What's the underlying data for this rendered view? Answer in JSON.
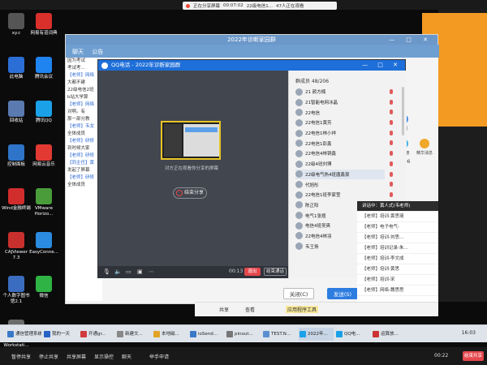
{
  "share_bar_top": {
    "sharing_text": "正在分享屏幕",
    "elapsed": "00:07:02",
    "group_text": "22级电信1...",
    "viewers_text": "47人正在观看"
  },
  "desktop_icons": [
    {
      "label": "xy.c",
      "color": "#555"
    },
    {
      "label": "网易有道词典",
      "color": "#d9302c"
    },
    {
      "label": "此电脑",
      "color": "#2b6fd6"
    },
    {
      "label": "腾讯会议",
      "color": "#1f84f0"
    },
    {
      "label": "回收站",
      "color": "#5a7ab0"
    },
    {
      "label": "腾讯QQ",
      "color": "#1ba1e8"
    },
    {
      "label": "控制面板",
      "color": "#2e74c8"
    },
    {
      "label": "网易云音乐",
      "color": "#e23a33"
    },
    {
      "label": "Wind金融终端",
      "color": "#d22d2d"
    },
    {
      "label": "VMware Horizo...",
      "color": "#4a9c3b"
    },
    {
      "label": "CAJViewer 7.3",
      "color": "#c8302e"
    },
    {
      "label": "EasyConne...",
      "color": "#2a8be0"
    },
    {
      "label": "个人数字图书馆2.1",
      "color": "#3a6dbf"
    },
    {
      "label": "微信",
      "color": "#2fb344"
    },
    {
      "label": "VMware Workstati...",
      "color": "#6b6b6b"
    }
  ],
  "main_window": {
    "title": "2022年诊断家园群",
    "tabs": [
      "聊天",
      "公告"
    ],
    "chat_lines": [
      "因为考试",
      "考试考...",
      "【老师】网络",
      "大都不建",
      "22级电信2班",
      "b站大学算",
      "【老师】网络",
      "对啊。有",
      "那一部分教",
      "【老师】韦龙",
      "全体成员",
      "【老师】研修",
      "到时候大家",
      "【老师】研修",
      "【同主任】黄",
      "发起了屏幕",
      "【老师】研修",
      "全体成员"
    ],
    "side_tools": [
      "空间",
      "群相册",
      "精华消息"
    ],
    "close_label": "关闭(C)",
    "send_label": "发送(S)",
    "member_count_back": "/206"
  },
  "call_window": {
    "title": "QQ电话 - 2022年诊断家园群",
    "share_hint": "对方正在观看你分享的屏幕",
    "end_share_label": "结束分享",
    "call_time": "00:13",
    "hangup_label": "退出",
    "end_call_label": "结束通话",
    "members_count": "群成员 48/206",
    "members": [
      "21 颜方楠",
      "21智能电网冰晶",
      "22电信",
      "22电信1黄芳",
      "22电信1林小祥",
      "22电信1彭鑫",
      "22电信4林铜鑫",
      "22级4班刘博",
      "22级电气热4班唐鑫豪",
      "代旭彤",
      "22电信1班李家莹",
      "陈正阳",
      "电气1张煜",
      "电信4班吴爽",
      "22电信4林羽",
      "韦王扬"
    ]
  },
  "qq_list": {
    "header": "讲话中：黄人式(韦老师)",
    "rows": [
      "【老师】培训-黄思琦",
      "【老师】电子电气-",
      "【老师】培训-刘思…",
      "【老师】培训记录-朱…",
      "【老师】培训-李文成",
      "【老师】培训-黄思",
      "【老师】培训-宋",
      "【老师】网络-魏思思"
    ]
  },
  "explorer": {
    "items": [
      "共享",
      "查看",
      "应用程序工具"
    ]
  },
  "taskbar": {
    "items": [
      {
        "label": "通信管理系统",
        "color": "#3a78c8"
      },
      {
        "label": "我的一天",
        "color": "#2563c7"
      },
      {
        "label": "开通gr...",
        "color": "#d13b3b"
      },
      {
        "label": "新建文...",
        "color": "#888"
      },
      {
        "label": "本地磁...",
        "color": "#e0a526"
      },
      {
        "label": "ioSend...",
        "color": "#3a78c8"
      },
      {
        "label": "pinout...",
        "color": "#777"
      },
      {
        "label": "TEST.N...",
        "color": "#5a8fd0"
      },
      {
        "label": "2022年...",
        "color": "#1ba1e8"
      },
      {
        "label": "QQ电...",
        "color": "#1ba1e8"
      },
      {
        "label": "运算放...",
        "color": "#c33"
      }
    ],
    "clock": "16:03"
  },
  "share_bar_bottom": {
    "items": [
      "暂停共享",
      "停止共享",
      "共享屏幕",
      "显示操控",
      "聊天",
      "举手申请"
    ],
    "time": "00:22",
    "stop_label": "结束共享"
  },
  "colors": {
    "accent": "#1e6fd9",
    "title_bar": "#6b97c9",
    "danger": "#e5484d",
    "share_frame": "#e8c426",
    "orange_panel": "#f39a22"
  }
}
